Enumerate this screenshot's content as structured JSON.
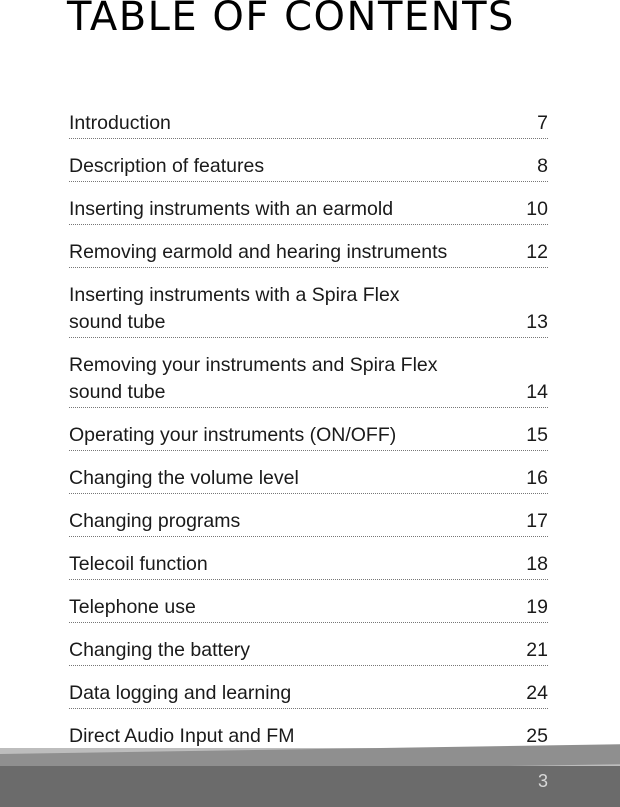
{
  "title": "TABLE OF CONTENTS",
  "entries": [
    {
      "label": "Introduction",
      "page": "7"
    },
    {
      "label": "Description of features",
      "page": "8"
    },
    {
      "label": "Inserting instruments with an earmold",
      "page": "10"
    },
    {
      "label": "Removing earmold and hearing instruments",
      "page": "12"
    },
    {
      "label": "Inserting instruments with a Spira Flex\nsound tube",
      "page": "13"
    },
    {
      "label": "Removing your instruments and Spira Flex\nsound tube",
      "page": "14"
    },
    {
      "label": "Operating your instruments (ON/OFF)",
      "page": "15"
    },
    {
      "label": "Changing the volume level",
      "page": "16"
    },
    {
      "label": "Changing programs",
      "page": "17"
    },
    {
      "label": "Telecoil function",
      "page": "18"
    },
    {
      "label": "Telephone use",
      "page": "19"
    },
    {
      "label": "Changing the battery",
      "page": "21"
    },
    {
      "label": "Data logging and learning",
      "page": "24"
    },
    {
      "label": "Direct Audio Input and FM",
      "page": "25"
    }
  ],
  "footer": {
    "page_number": "3"
  }
}
